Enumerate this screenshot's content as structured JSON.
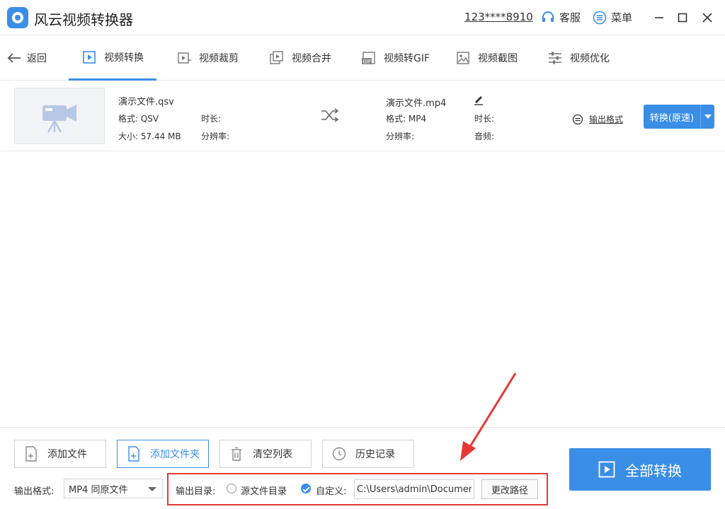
{
  "app": {
    "title": "风云视频转换器",
    "user": "123****8910",
    "service": "客服",
    "menu": "菜单"
  },
  "nav": {
    "back": "返回",
    "tabs": [
      {
        "label": "视频转换",
        "icon": "video-play-icon",
        "active": true
      },
      {
        "label": "视频裁剪",
        "icon": "video-crop-icon",
        "active": false
      },
      {
        "label": "视频合并",
        "icon": "video-merge-icon",
        "active": false
      },
      {
        "label": "视频转GIF",
        "icon": "gif-icon",
        "active": false
      },
      {
        "label": "视频截图",
        "icon": "image-icon",
        "active": false
      },
      {
        "label": "视频优化",
        "icon": "sliders-icon",
        "active": false
      }
    ]
  },
  "file": {
    "source": {
      "name": "演示文件.qsv",
      "format_label": "格式: QSV",
      "duration_label": "时长:",
      "size_label": "大小: 57.44 MB",
      "resolution_label": "分辨率:"
    },
    "target": {
      "name": "演示文件.mp4",
      "format_label": "格式: MP4",
      "duration_label": "时长:",
      "resolution_label": "分辨率:",
      "audio_label": "音频:"
    },
    "output_format_link": "输出格式",
    "convert_button": "转换(原速)"
  },
  "bottom": {
    "buttons": {
      "add_file": "添加文件",
      "add_folder": "添加文件夹",
      "clear_list": "清空列表",
      "history": "历史记录"
    },
    "convert_all": "全部转换",
    "output_format_label": "输出格式:",
    "output_format_value": "MP4 同原文件",
    "output_dir_label": "输出目录:",
    "radio_source": "源文件目录",
    "radio_custom": "自定义:",
    "path_value": "C:\\Users\\admin\\Documents",
    "change_path": "更改路径"
  },
  "colors": {
    "accent": "#3a8ee6",
    "annotation": "#e53935"
  }
}
